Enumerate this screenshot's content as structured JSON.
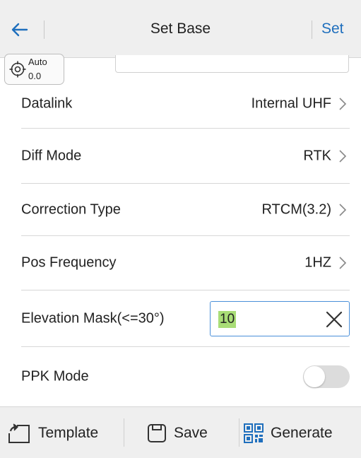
{
  "header": {
    "title": "Set Base",
    "set_label": "Set"
  },
  "gnss": {
    "mode": "Auto",
    "value": "0.0"
  },
  "rows": [
    {
      "label": "Datalink",
      "value": "Internal UHF"
    },
    {
      "label": "Diff Mode",
      "value": "RTK"
    },
    {
      "label": "Correction Type",
      "value": "RTCM(3.2)"
    },
    {
      "label": "Pos Frequency",
      "value": "1HZ"
    }
  ],
  "elevation": {
    "label": "Elevation Mask(<=30°)",
    "value": "10"
  },
  "ppk": {
    "label": "PPK Mode",
    "enabled": false
  },
  "footer": {
    "template_label": "Template",
    "save_label": "Save",
    "generate_label": "Generate"
  },
  "colors": {
    "accent": "#1f6fbd",
    "input_border": "#4a90d9",
    "selection_highlight": "#a9dd77",
    "bar_background": "#efefef"
  },
  "icons": [
    "back-arrow-icon",
    "target-icon",
    "chevron-right-icon",
    "clear-icon",
    "template-icon",
    "save-icon",
    "qr-code-icon"
  ]
}
